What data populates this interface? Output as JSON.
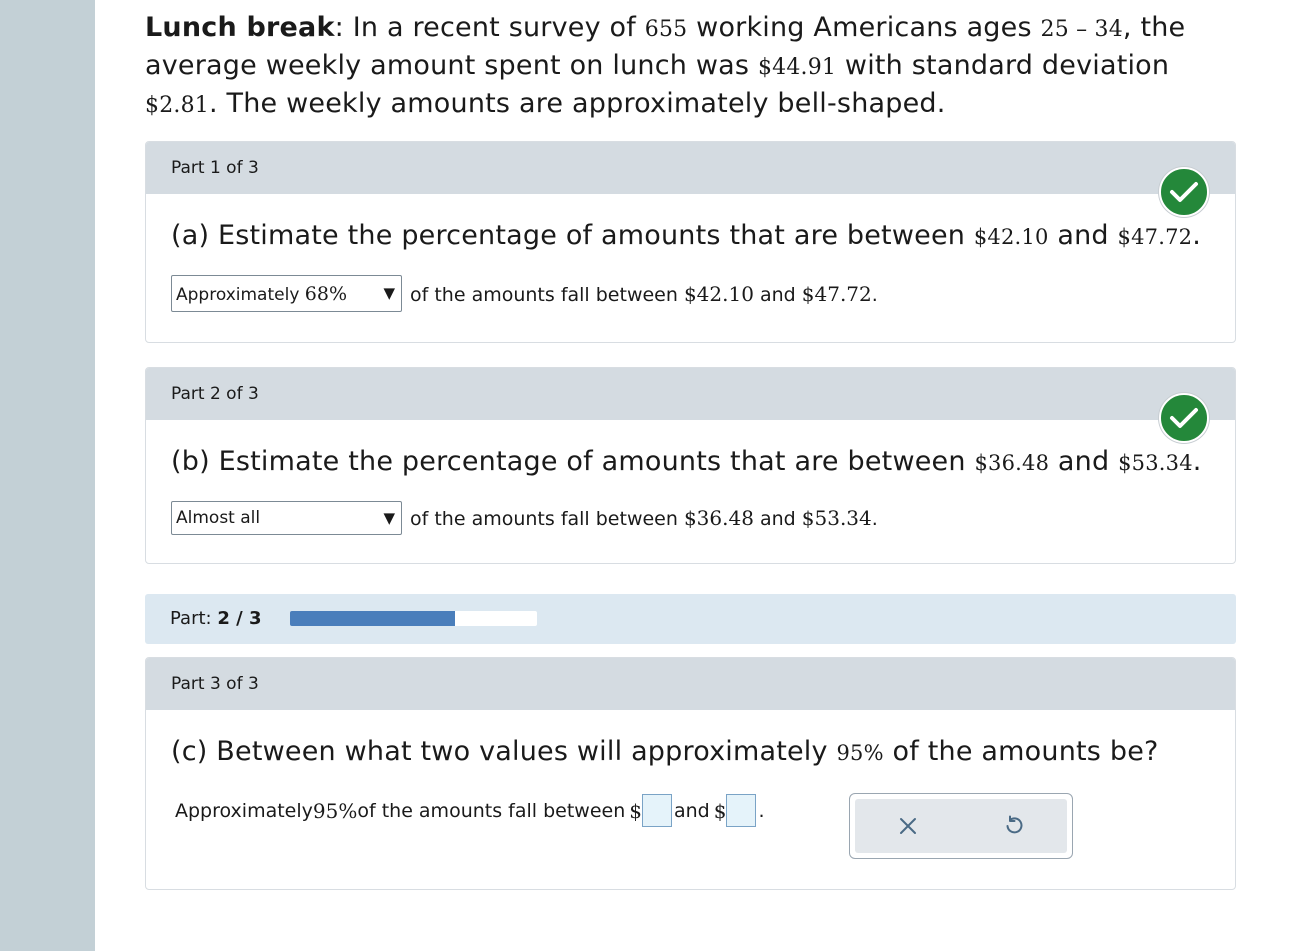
{
  "intro": {
    "title": "Lunch break",
    "text_1": ": In a recent survey of ",
    "n": "655",
    "text_2": " working Americans ages ",
    "ages": "25 – 34",
    "text_3": ", the average weekly amount spent on lunch was ",
    "mean": "$44.91",
    "text_4": " with standard deviation ",
    "sd": "$2.81",
    "text_5": ". The weekly amounts are approximately bell-shaped."
  },
  "parts": [
    {
      "header": "Part 1 of 3",
      "q_prefix": "(a) Estimate the percentage of amounts that are between ",
      "low": "$42.10",
      "and": " and ",
      "high": "$47.72",
      "period": ".",
      "selected_word": "Approximately ",
      "selected_num": "68%",
      "tail_1": "of the amounts fall between ",
      "tail_low": "$42.10",
      "tail_and": " and ",
      "tail_high": "$47.72",
      "tail_period": "."
    },
    {
      "header": "Part 2 of 3",
      "q_prefix": "(b) Estimate the percentage of amounts that are between ",
      "low": "$36.48",
      "and": " and ",
      "high": "$53.34",
      "period": ".",
      "selected": "Almost all",
      "tail_1": "of the amounts fall between ",
      "tail_low": "$36.48",
      "tail_and": " and ",
      "tail_high": "$53.34",
      "tail_period": "."
    },
    {
      "header": "Part 3 of 3",
      "q_prefix": "(c) Between what two values will approximately ",
      "pct": "95%",
      "q_suffix": " of the amounts be?",
      "a_prefix": "Approximately ",
      "a_pct": "95%",
      "a_mid": " of the amounts fall between ",
      "dollar": "$",
      "and": " and ",
      "period": ".",
      "input_1": "",
      "input_2": ""
    }
  ],
  "progress": {
    "label": "Part: ",
    "value": "2 / 3",
    "fraction": 0.6667
  },
  "icons": {
    "check": "check-circle-icon",
    "clear": "x-icon",
    "undo": "undo-icon"
  },
  "colors": {
    "check_green": "#24883a",
    "progress_fill": "#4a7ebb",
    "header_gray": "#d4dbe1"
  }
}
